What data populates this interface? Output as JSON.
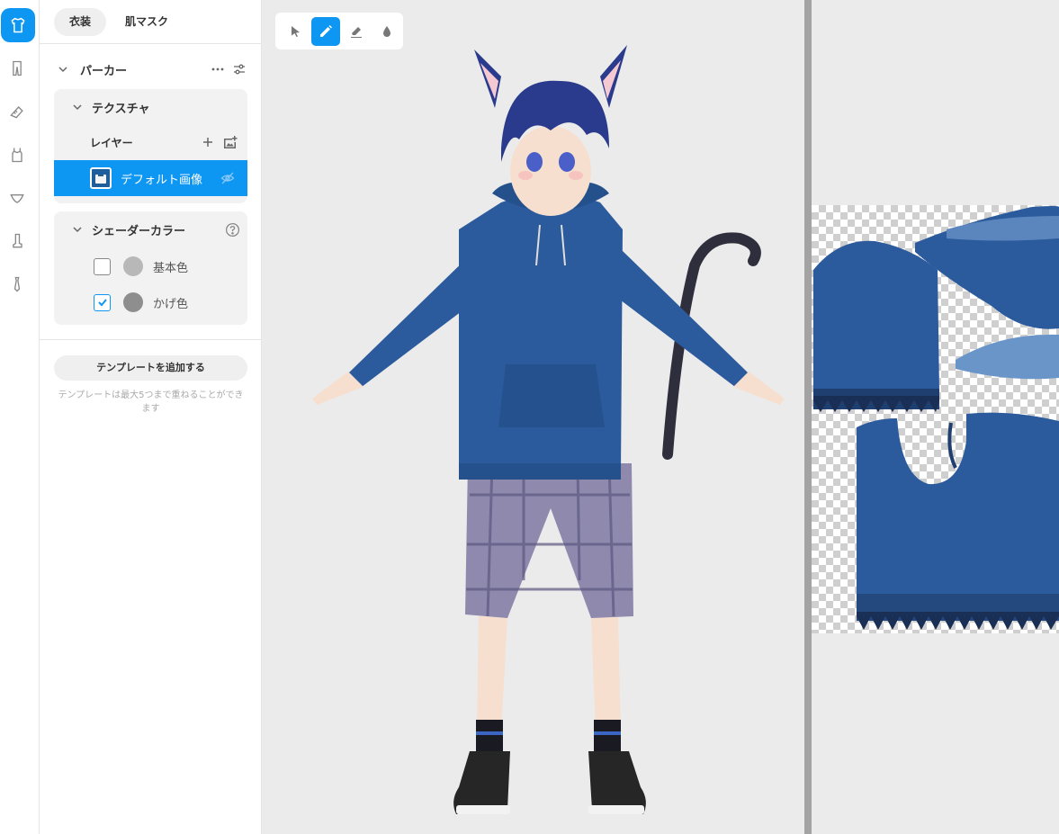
{
  "tabs": [
    {
      "label": "衣装",
      "active": true
    },
    {
      "label": "肌マスク",
      "active": false
    }
  ],
  "rail": {
    "items": [
      {
        "icon": "shirt-icon",
        "active": true
      },
      {
        "icon": "pants-icon",
        "active": false
      },
      {
        "icon": "shoe-icon",
        "active": false
      },
      {
        "icon": "tanktop-icon",
        "active": false
      },
      {
        "icon": "underwear-icon",
        "active": false
      },
      {
        "icon": "sock-icon",
        "active": false
      },
      {
        "icon": "tie-icon",
        "active": false
      }
    ]
  },
  "garment": {
    "title": "パーカー"
  },
  "texture": {
    "title": "テクスチャ",
    "layers_label": "レイヤー",
    "selected_layer": "デフォルト画像"
  },
  "shader": {
    "title": "シェーダーカラー",
    "colors": [
      {
        "label": "基本色",
        "checked": false,
        "color": "#b8b8b8"
      },
      {
        "label": "かげ色",
        "checked": true,
        "color": "#8e8e8e"
      }
    ]
  },
  "template": {
    "add_label": "テンプレートを追加する",
    "note": "テンプレートは最大5つまで重ねることができます"
  },
  "toolbar": {
    "tools": [
      {
        "icon": "cursor-icon",
        "active": false
      },
      {
        "icon": "pencil-icon",
        "active": true
      },
      {
        "icon": "eraser-icon",
        "active": false
      },
      {
        "icon": "drop-fill-icon",
        "active": false
      }
    ]
  },
  "colors": {
    "accent": "#0d96f2",
    "hoodie": "#2b5b9c",
    "hair": "#2a3a8c",
    "shorts": "#8e89ad",
    "skin": "#f6dfcf"
  }
}
